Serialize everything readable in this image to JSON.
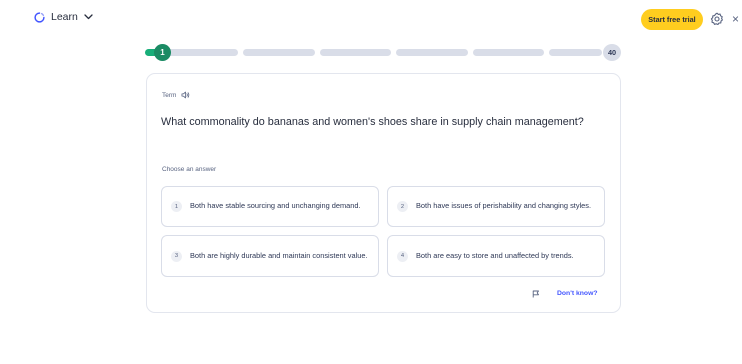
{
  "header": {
    "mode_label": "Learn",
    "mode_icon": "learn-mode-icon",
    "trial_button": "Start free trial",
    "settings_icon": "gear-icon",
    "close_label": "×"
  },
  "progress": {
    "current": "1",
    "total": "40",
    "completed_fraction": 0.025,
    "colors": {
      "done": "#18ae79",
      "current": "#1b8b64",
      "remaining": "#d9dde8"
    }
  },
  "card": {
    "term_label": "Term",
    "question": "What commonality do bananas and women's shoes share in supply chain management?",
    "choose_label": "Choose an answer",
    "options": [
      {
        "num": "1",
        "text": "Both have stable sourcing and unchanging demand."
      },
      {
        "num": "2",
        "text": "Both have issues of perishability and changing styles."
      },
      {
        "num": "3",
        "text": "Both are highly durable and maintain consistent value."
      },
      {
        "num": "4",
        "text": "Both are easy to store and unaffected by trends."
      }
    ],
    "dont_know": "Don't know?"
  },
  "colors": {
    "accent": "#4255ff",
    "trial": "#ffcd1f",
    "text": "#2e3856"
  }
}
